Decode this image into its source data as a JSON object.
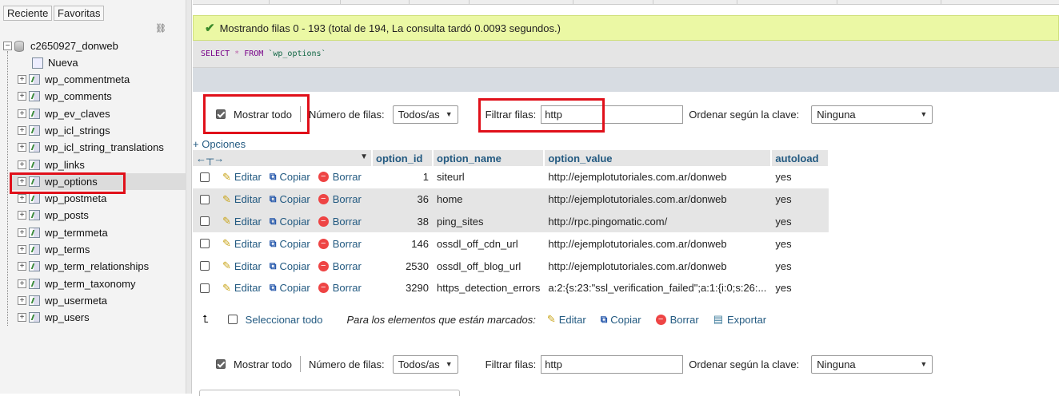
{
  "sidebar": {
    "tabs": [
      "Reciente",
      "Favoritas"
    ],
    "database": "c2650927_donweb",
    "new_label": "Nueva",
    "tables": [
      "wp_commentmeta",
      "wp_comments",
      "wp_ev_claves",
      "wp_icl_strings",
      "wp_icl_string_translations",
      "wp_links",
      "wp_options",
      "wp_postmeta",
      "wp_posts",
      "wp_termmeta",
      "wp_terms",
      "wp_term_relationships",
      "wp_term_taxonomy",
      "wp_usermeta",
      "wp_users"
    ],
    "selected": "wp_options"
  },
  "message": "Mostrando filas 0 - 193 (total de 194, La consulta tardó 0.0093 segundos.)",
  "sql": {
    "select": "SELECT",
    "star": "*",
    "from": "FROM",
    "table": "`wp_options`"
  },
  "nav": {
    "show_all": "Mostrar todo",
    "rows_label": "Número de filas:",
    "rows_value": "Todos/as",
    "filter_label": "Filtrar filas:",
    "filter_value": "http",
    "sort_label": "Ordenar según la clave:",
    "sort_value": "Ninguna"
  },
  "options_link": "+ Opciones",
  "columns": [
    "option_id",
    "option_name",
    "option_value",
    "autoload"
  ],
  "actions": {
    "edit": "Editar",
    "copy": "Copiar",
    "delete": "Borrar",
    "export": "Exportar"
  },
  "rows": [
    {
      "id": "1",
      "name": "siteurl",
      "value": "http://ejemplotutoriales.com.ar/donweb",
      "autoload": "yes"
    },
    {
      "id": "36",
      "name": "home",
      "value": "http://ejemplotutoriales.com.ar/donweb",
      "autoload": "yes"
    },
    {
      "id": "38",
      "name": "ping_sites",
      "value": "http://rpc.pingomatic.com/",
      "autoload": "yes"
    },
    {
      "id": "146",
      "name": "ossdl_off_cdn_url",
      "value": "http://ejemplotutoriales.com.ar/donweb",
      "autoload": "yes"
    },
    {
      "id": "2530",
      "name": "ossdl_off_blog_url",
      "value": "http://ejemplotutoriales.com.ar/donweb",
      "autoload": "yes"
    },
    {
      "id": "3290",
      "name": "https_detection_errors",
      "value": "a:2:{s:23:\"ssl_verification_failed\";a:1:{i:0;s:26:...",
      "autoload": "yes"
    }
  ],
  "select_all": "Seleccionar todo",
  "marked_label": "Para los elementos que están marcados:"
}
